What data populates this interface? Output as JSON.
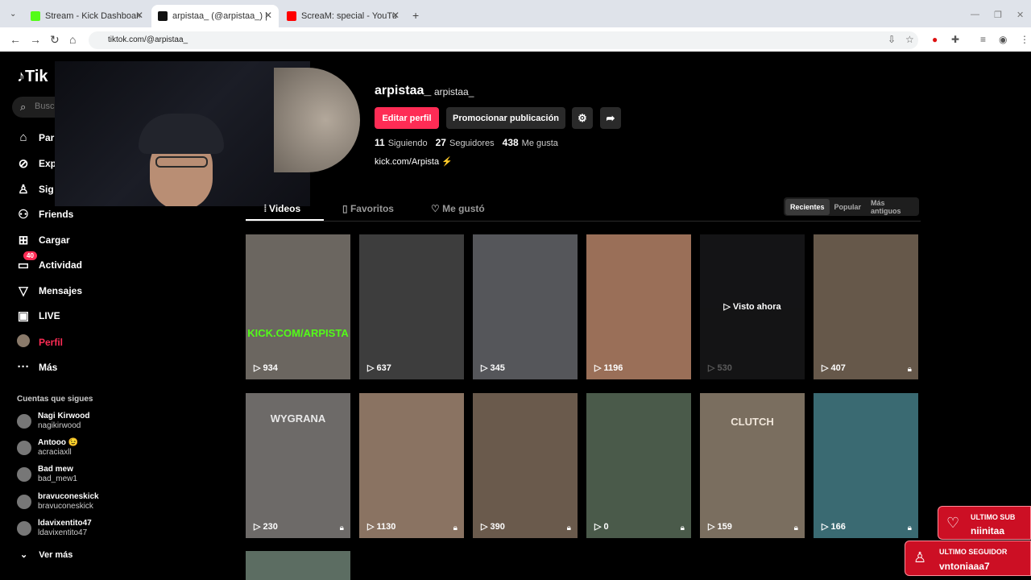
{
  "browser": {
    "tabs": [
      {
        "title": "Stream - Kick Dashboard",
        "color": "#53fc18"
      },
      {
        "title": "arpistaa_ (@arpistaa_) | TikTok",
        "color": "#111111"
      },
      {
        "title": "ScreaM: special - YouTube",
        "color": "#ff0000"
      }
    ],
    "url": "tiktok.com/@arpistaa_"
  },
  "sidebar": {
    "logo": "Tik",
    "search_placeholder": "Busc",
    "items": [
      {
        "label": "Par",
        "icon": "home-icon"
      },
      {
        "label": "Exp",
        "icon": "compass-icon"
      },
      {
        "label": "Sig",
        "icon": "following-icon"
      },
      {
        "label": "Friends",
        "icon": "friends-icon"
      },
      {
        "label": "Cargar",
        "icon": "upload-icon"
      },
      {
        "label": "Actividad",
        "icon": "inbox-icon",
        "badge": "40"
      },
      {
        "label": "Mensajes",
        "icon": "messages-icon"
      },
      {
        "label": "LIVE",
        "icon": "live-icon"
      },
      {
        "label": "Perfil",
        "icon": "profile-avatar"
      },
      {
        "label": "Más",
        "icon": "more-icon"
      }
    ],
    "following_title": "Cuentas que sigues",
    "following": [
      {
        "name": "Nagi Kirwood",
        "user": "nagikirwood"
      },
      {
        "name": "Antooo 😉",
        "user": "acraciaxll"
      },
      {
        "name": "Bad mew",
        "user": "bad_mew1"
      },
      {
        "name": "bravuconeskick",
        "user": "bravuconeskick"
      },
      {
        "name": "ldavixentito47",
        "user": "ldavixentito47"
      }
    ],
    "see_more": "Ver más"
  },
  "profile": {
    "username": "arpistaa_",
    "handle": "arpistaa_",
    "edit_button": "Editar perfil",
    "promote_button": "Promocionar publicación",
    "stats": [
      {
        "value": "11",
        "label": "Siguiendo"
      },
      {
        "value": "27",
        "label": "Seguidores"
      },
      {
        "value": "438",
        "label": "Me gusta"
      }
    ],
    "bio": "kick.com/Arpista ⚡"
  },
  "tabs": [
    {
      "label": "Videos"
    },
    {
      "label": "Favoritos"
    },
    {
      "label": "Me gustó"
    }
  ],
  "sort": [
    "Recientes",
    "Popular",
    "Más antiguos"
  ],
  "videos": [
    {
      "views": "934",
      "overlay": "KICK.COM/ARPISTA",
      "bg": "#6b6660"
    },
    {
      "views": "637",
      "overlay": "",
      "bg": "#3d3d3d"
    },
    {
      "views": "345",
      "overlay": "",
      "bg": "#55565a"
    },
    {
      "views": "1196",
      "overlay": "",
      "bg": "#9a6f58"
    },
    {
      "views": "530",
      "overlay": "",
      "bg": "#3a3a3e",
      "watched": "Visto ahora"
    },
    {
      "views": "407",
      "overlay": "",
      "bg": "#66584a"
    },
    {
      "views": "230",
      "overlay": "WYGRANA",
      "bg": "#6d6a68"
    },
    {
      "views": "1130",
      "overlay": "",
      "bg": "#8a7362"
    },
    {
      "views": "390",
      "overlay": "",
      "bg": "#6a5a4c"
    },
    {
      "views": "0",
      "overlay": "",
      "bg": "#4a5a4a"
    },
    {
      "views": "159",
      "overlay": "CLUTCH",
      "bg": "#7a6e5f"
    },
    {
      "views": "166",
      "overlay": "",
      "bg": "#3a6a72"
    }
  ],
  "alerts": {
    "sub_label": "ULTIMO SUB",
    "sub_value": "niinitaa",
    "follower_label": "ULTIMO SEGUIDOR",
    "follower_value": "vntoniaaa7"
  }
}
